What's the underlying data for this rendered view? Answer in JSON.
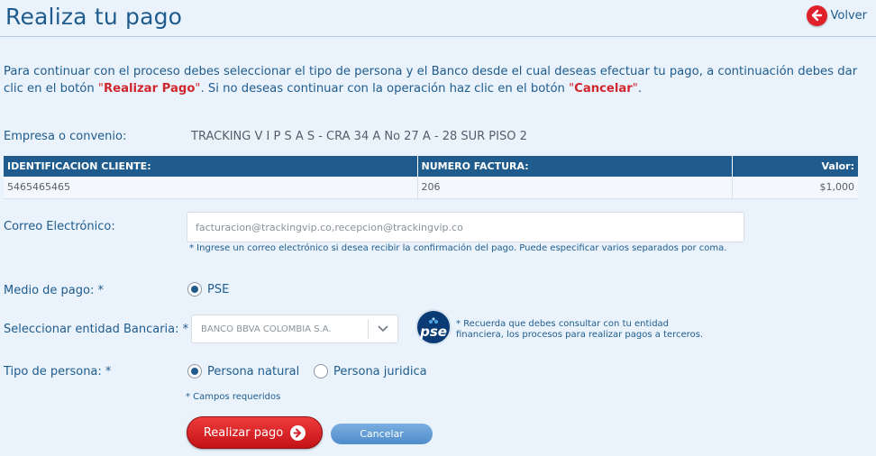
{
  "header": {
    "title": "Realiza tu pago",
    "back_label": "Volver"
  },
  "intro": {
    "part1": "Para continuar con el proceso debes seleccionar el tipo de persona y el Banco desde el cual deseas efectuar tu pago, a continuación debes dar clic en el botón ",
    "pay_label": "Realizar Pago",
    "part2": ". Si no deseas continuar con la operación haz clic en el botón ",
    "cancel_label": "Cancelar",
    "part3": "."
  },
  "company": {
    "label": "Empresa o convenio:",
    "value": "TRACKING V I P S A S - CRA 34 A No 27 A - 28 SUR PISO 2"
  },
  "table": {
    "headers": [
      "IDENTIFICACION CLIENTE:",
      "NUMERO FACTURA:",
      "Valor:"
    ],
    "rows": [
      [
        "5465465465",
        "206",
        "$1,000"
      ]
    ]
  },
  "email": {
    "label": "Correo Electrónico:",
    "value": "facturacion@trackingvip.co,recepcion@trackingvip.co",
    "hint": "* Ingrese un correo electrónico si desea recibir la confirmación del pago. Puede especificar varios separados por coma."
  },
  "payment_method": {
    "label": "Medio de pago: *",
    "option": "PSE",
    "selected": true
  },
  "bank": {
    "label": "Seleccionar entidad Bancaria: *",
    "selected": "BANCO BBVA COLOMBIA S.A.",
    "logo_text": "pse",
    "note": "* Recuerda que debes consultar con tu entidad financiera,   los procesos para realizar pagos a terceros."
  },
  "person_type": {
    "label": "Tipo de persona: *",
    "options": [
      "Persona natural",
      "Persona juridica"
    ],
    "selected_index": 0
  },
  "required_note": "* Campos requeridos",
  "actions": {
    "pay": "Realizar pago",
    "cancel": "Cancelar"
  },
  "colors": {
    "brand_blue": "#1f5c8d",
    "accent_red": "#d0262d",
    "background": "#eaf3fb"
  }
}
